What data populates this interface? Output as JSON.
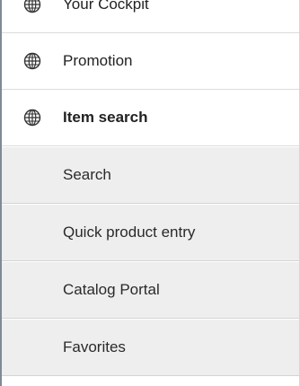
{
  "menu": {
    "items": [
      {
        "label": "Your Cockpit",
        "icon": "globe-icon"
      },
      {
        "label": "Promotion",
        "icon": "globe-icon"
      },
      {
        "label": "Item search",
        "icon": "globe-icon",
        "active": true
      }
    ],
    "subitems": [
      {
        "label": "Search"
      },
      {
        "label": "Quick product entry"
      },
      {
        "label": "Catalog Portal"
      },
      {
        "label": "Favorites"
      }
    ]
  },
  "colors": {
    "submenu_background": "#eeeeee",
    "divider": "#dcdcdc",
    "left_edge": "#7d8a99"
  }
}
